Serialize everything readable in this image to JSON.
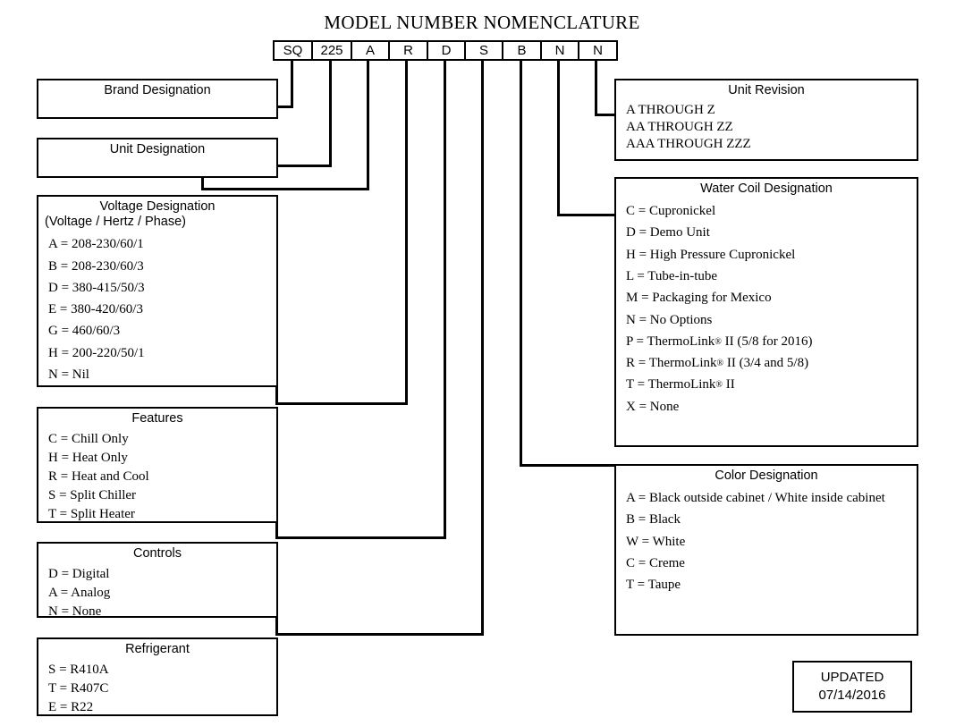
{
  "title": "MODEL NUMBER NOMENCLATURE",
  "model_number": {
    "cells": [
      {
        "value": "SQ",
        "name": "brand"
      },
      {
        "value": "225",
        "name": "unit"
      },
      {
        "value": "A",
        "name": "voltage"
      },
      {
        "value": "R",
        "name": "features"
      },
      {
        "value": "D",
        "name": "controls"
      },
      {
        "value": "S",
        "name": "refrigerant"
      },
      {
        "value": "B",
        "name": "color"
      },
      {
        "value": "N",
        "name": "water-coil"
      },
      {
        "value": "N",
        "name": "unit-revision"
      }
    ]
  },
  "boxes": {
    "brand_designation": {
      "heading": "Brand Designation",
      "items": []
    },
    "unit_designation": {
      "heading": "Unit Designation",
      "items": []
    },
    "voltage_designation": {
      "heading": "Voltage Designation",
      "subheading": "(Voltage / Hertz / Phase)",
      "items": [
        "A = 208-230/60/1",
        "B = 208-230/60/3",
        "D = 380-415/50/3",
        "E = 380-420/60/3",
        "G = 460/60/3",
        "H = 200-220/50/1",
        "N = Nil"
      ]
    },
    "features": {
      "heading": "Features",
      "items": [
        "C = Chill Only",
        "H = Heat Only",
        "R = Heat and Cool",
        "S = Split Chiller",
        "T = Split Heater"
      ]
    },
    "controls": {
      "heading": "Controls",
      "items": [
        "D = Digital",
        "A = Analog",
        "N = None"
      ]
    },
    "refrigerant": {
      "heading": "Refrigerant",
      "items": [
        "S = R410A",
        "T = R407C",
        "E = R22"
      ]
    },
    "unit_revision": {
      "heading": "Unit Revision",
      "items": [
        "A THROUGH Z",
        "AA THROUGH ZZ",
        "AAA THROUGH ZZZ"
      ]
    },
    "water_coil_designation": {
      "heading": "Water Coil Designation",
      "items": [
        {
          "text": "C = Cupronickel"
        },
        {
          "text": "D = Demo Unit"
        },
        {
          "text": "H = High Pressure Cupronickel"
        },
        {
          "text": "L = Tube-in-tube"
        },
        {
          "text": "M = Packaging for Mexico"
        },
        {
          "text": "N = No Options"
        },
        {
          "pre": "P = ThermoLink",
          "reg": "®",
          "post": " II (5/8 for 2016)"
        },
        {
          "pre": "R = ThermoLink",
          "reg": "®",
          "post": " II (3/4 and 5/8)"
        },
        {
          "pre": "T = ThermoLink",
          "reg": "®",
          "post": " II"
        },
        {
          "text": "X = None"
        }
      ]
    },
    "color_designation": {
      "heading": "Color Designation",
      "items": [
        "A = Black outside cabinet / White inside cabinet",
        "B = Black",
        "W = White",
        "C = Creme",
        "T = Taupe"
      ]
    }
  },
  "updated": {
    "label": "UPDATED",
    "date": "07/14/2016"
  },
  "colors": {
    "ink": "#000000",
    "paper": "#ffffff"
  }
}
